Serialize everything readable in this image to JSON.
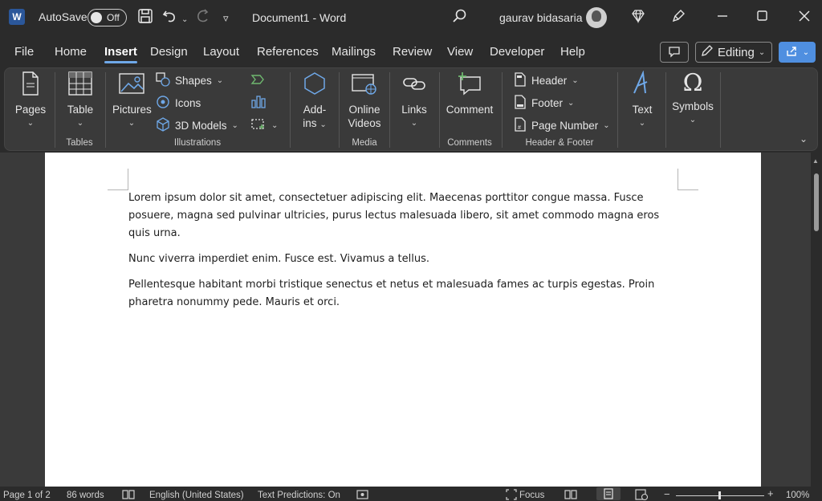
{
  "titlebar": {
    "app_icon": "word-logo-icon",
    "app_icon_letter": "W",
    "autosave_label": "AutoSave",
    "autosave_state": "Off",
    "document_title": "Document1  -  Word",
    "user_name": "gaurav bidasaria"
  },
  "tabs": [
    "File",
    "Home",
    "Insert",
    "Design",
    "Layout",
    "References",
    "Mailings",
    "Review",
    "View",
    "Developer",
    "Help"
  ],
  "active_tab": "Insert",
  "actions": {
    "editing_label": "Editing"
  },
  "ribbon": {
    "pages": "Pages",
    "table": "Table",
    "pictures": "Pictures",
    "shapes": "Shapes",
    "icons": "Icons",
    "models3d": "3D Models",
    "addins_line1": "Add-",
    "addins_line2": "ins",
    "online_videos_line1": "Online",
    "online_videos_line2": "Videos",
    "links": "Links",
    "comment": "Comment",
    "header": "Header",
    "footer": "Footer",
    "page_number": "Page Number",
    "text": "Text",
    "symbols": "Symbols",
    "groups": {
      "tables": "Tables",
      "illustrations": "Illustrations",
      "media": "Media",
      "comments": "Comments",
      "header_footer": "Header & Footer"
    }
  },
  "document": {
    "paragraphs": [
      "Lorem ipsum dolor sit amet, consectetuer adipiscing elit. Maecenas porttitor congue massa. Fusce posuere, magna sed pulvinar ultricies, purus lectus malesuada libero, sit amet commodo magna eros quis urna.",
      "Nunc viverra imperdiet enim. Fusce est. Vivamus a tellus.",
      "Pellentesque habitant morbi tristique senectus et netus et malesuada fames ac turpis egestas. Proin pharetra nonummy pede. Mauris et orci."
    ]
  },
  "statusbar": {
    "page": "Page 1 of 2",
    "words": "86 words",
    "language": "English (United States)",
    "text_predictions": "Text Predictions: On",
    "focus": "Focus",
    "zoom": "100%"
  },
  "colors": {
    "accent": "#4f8fe0",
    "chrome": "#2b2b2b",
    "ribbon": "#3a3a3a",
    "page": "#ffffff"
  }
}
